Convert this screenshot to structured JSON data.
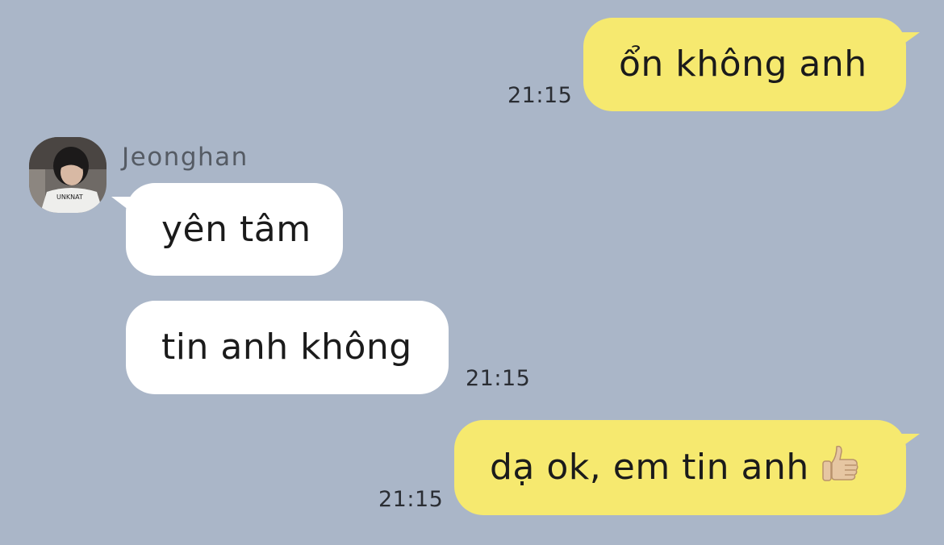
{
  "colors": {
    "background": "#aab6c8",
    "outgoing_bubble": "#f6e96f",
    "incoming_bubble": "#ffffff"
  },
  "messages": [
    {
      "direction": "outgoing",
      "text": "ổn không anh",
      "time": "21:15"
    },
    {
      "direction": "incoming",
      "sender": "Jeonghan",
      "text": "yên tâm"
    },
    {
      "direction": "incoming",
      "text": "tin anh không",
      "time": "21:15"
    },
    {
      "direction": "outgoing",
      "text": "dạ ok, em tin anh",
      "emoji": "thumbs-up-icon",
      "time": "21:15"
    }
  ]
}
